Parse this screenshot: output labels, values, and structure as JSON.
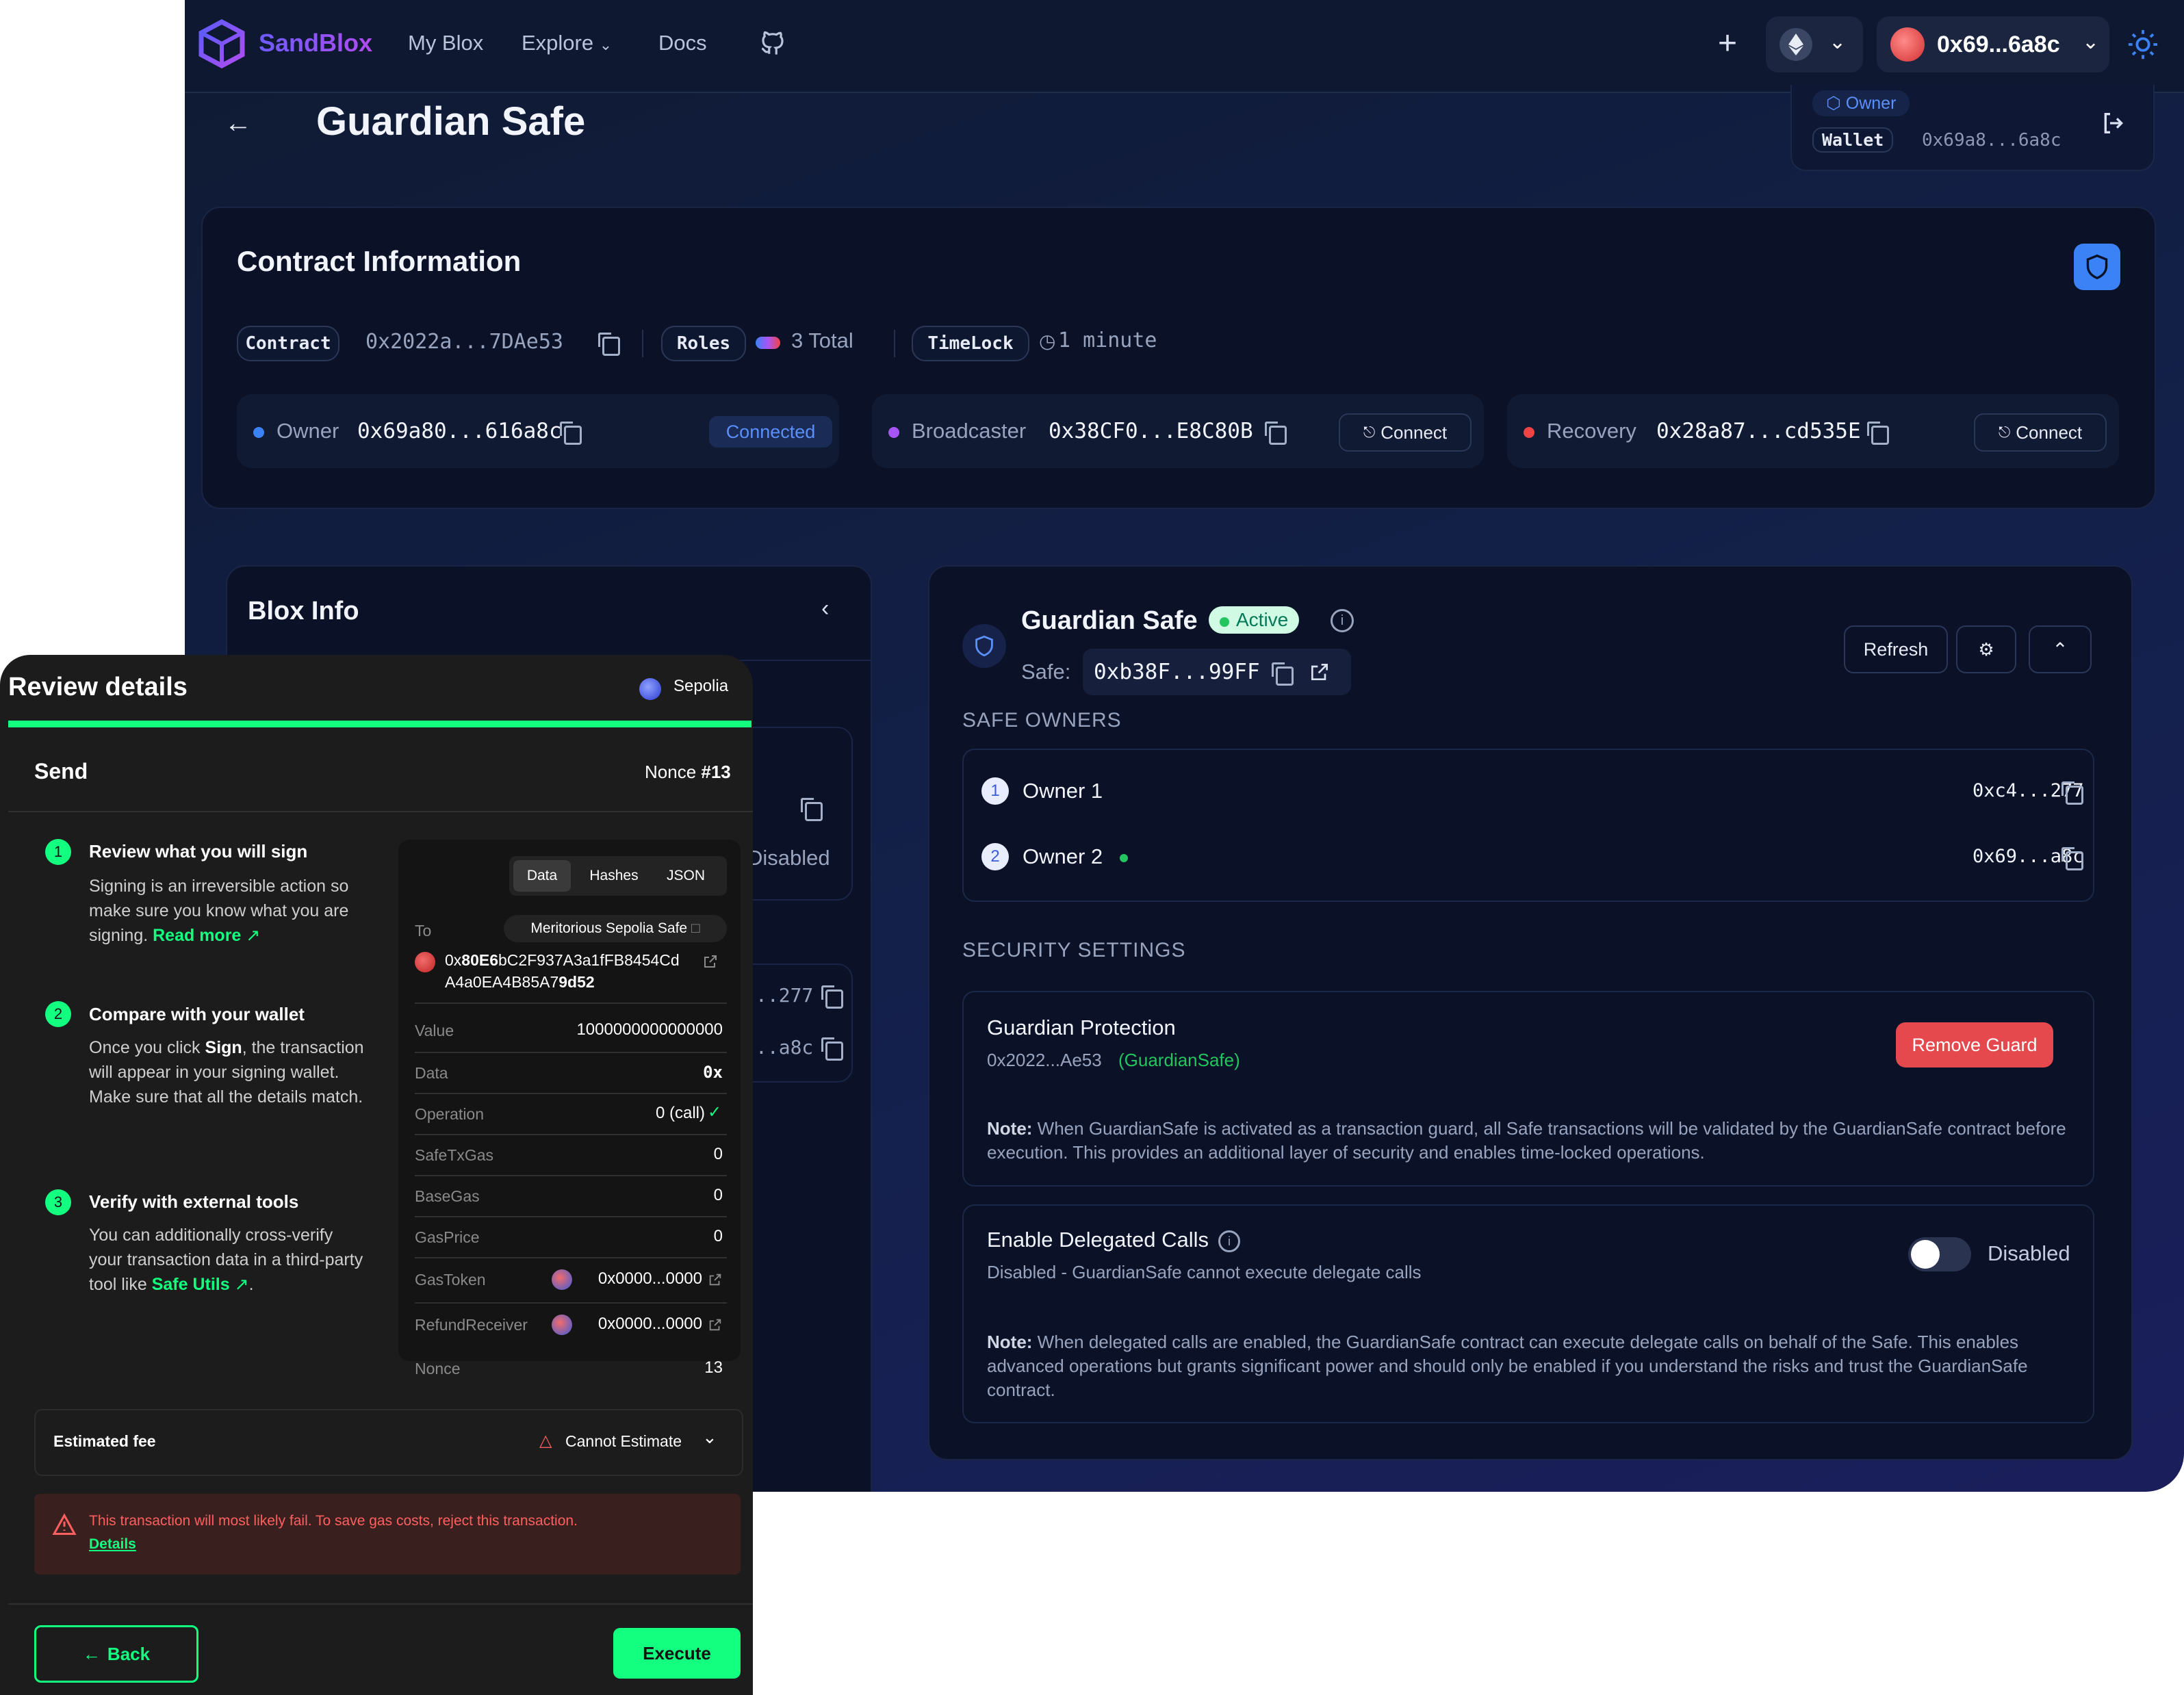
{
  "header": {
    "brand": "SandBlox",
    "nav": [
      "My Blox",
      "Explore",
      "Docs"
    ],
    "account": "0x69...6a8c"
  },
  "page": {
    "title": "Guardian Safe",
    "role_badge": "Owner",
    "wallet_label": "Wallet",
    "wallet_address": "0x69a8...6a8c"
  },
  "contract_info": {
    "title": "Contract Information",
    "contract_label": "Contract",
    "contract_address": "0x2022a...7DAe53",
    "roles_label": "Roles",
    "roles_value": "3 Total",
    "timelock_label": "TimeLock",
    "timelock_value": "1 minute",
    "roles": [
      {
        "name": "Owner",
        "address": "0x69a80...616a8c",
        "action": "Connected",
        "color": "#3b82f6"
      },
      {
        "name": "Broadcaster",
        "address": "0x38CF0...E8C80B",
        "action": "Connect",
        "color": "#a855f7"
      },
      {
        "name": "Recovery",
        "address": "0x28a87...cd535E",
        "action": "Connect",
        "color": "#ef4444"
      }
    ]
  },
  "blox_info": {
    "title": "Blox Info",
    "partial_disabled": "Disabled",
    "partial_addr_1": "..277",
    "partial_addr_2": "..a8c"
  },
  "guardian_panel": {
    "title": "Guardian Safe",
    "status": "Active",
    "safe_label": "Safe:",
    "safe_address": "0xb38F...99FF",
    "refresh": "Refresh",
    "owners_heading": "SAFE OWNERS",
    "owners": [
      {
        "index": "1",
        "name": "Owner 1",
        "address": "0xc4...277"
      },
      {
        "index": "2",
        "name": "Owner 2",
        "address": "0x69...a8c"
      }
    ],
    "security_heading": "SECURITY SETTINGS",
    "guardian_protection": {
      "title": "Guardian Protection",
      "address": "0x2022...Ae53",
      "tag": "(GuardianSafe)",
      "button": "Remove Guard",
      "note_label": "Note:",
      "note": "When GuardianSafe is activated as a transaction guard, all Safe transactions will be validated by the GuardianSafe contract before execution. This provides an additional layer of security and enables time-locked operations."
    },
    "delegated": {
      "title": "Enable Delegated Calls",
      "subtitle": "Disabled - GuardianSafe cannot execute delegate calls",
      "toggle_label": "Disabled",
      "note_label": "Note:",
      "note": "When delegated calls are enabled, the GuardianSafe contract can execute delegate calls on behalf of the Safe. This enables advanced operations but grants significant power and should only be enabled if you understand the risks and trust the GuardianSafe contract."
    }
  },
  "modal": {
    "title": "Review details",
    "network": "Sepolia",
    "section": "Send",
    "nonce_label": "Nonce",
    "nonce_value": "#13",
    "steps": [
      {
        "num": "1",
        "title": "Review what you will sign",
        "body": "Signing is an irreversible action so make sure you know what you are signing.",
        "link": "Read more"
      },
      {
        "num": "2",
        "title": "Compare with your wallet",
        "body_pre": "Once you click ",
        "body_bold": "Sign",
        "body_post": ", the transaction will appear in your signing wallet. Make sure that all the details match."
      },
      {
        "num": "3",
        "title": "Verify with external tools",
        "body": "You can additionally cross-verify your transaction data in a third-party tool like",
        "link": "Safe Utils"
      }
    ],
    "tabs": [
      "Data",
      "Hashes",
      "JSON"
    ],
    "tx": {
      "to_label": "To",
      "to_name": "Meritorious Sepolia Safe",
      "to_addr_1a": "0x",
      "to_addr_1b": "80E6",
      "to_addr_1c": "bC2F937A3a1fFB8454Cd",
      "to_addr_2a": "A4a0EA4B85A7",
      "to_addr_2b": "9d52",
      "rows": [
        {
          "label": "Value",
          "value": "1000000000000000"
        },
        {
          "label": "Data",
          "value": "0x"
        },
        {
          "label": "Operation",
          "value": "0 (call)"
        },
        {
          "label": "SafeTxGas",
          "value": "0"
        },
        {
          "label": "BaseGas",
          "value": "0"
        },
        {
          "label": "GasPrice",
          "value": "0"
        },
        {
          "label": "GasToken",
          "value": "0x0000...0000"
        },
        {
          "label": "RefundReceiver",
          "value": "0x0000...0000"
        },
        {
          "label": "Nonce",
          "value": "13"
        }
      ]
    },
    "fee_label": "Estimated fee",
    "fee_value": "Cannot Estimate",
    "warning": "This transaction will most likely fail. To save gas costs, reject this transaction.",
    "warning_link": "Details",
    "back": "Back",
    "execute": "Execute",
    "progress": 1.0
  },
  "colors": {
    "accent_green": "#12ff80",
    "danger": "#e5484d",
    "primary": "#3b82f6"
  }
}
